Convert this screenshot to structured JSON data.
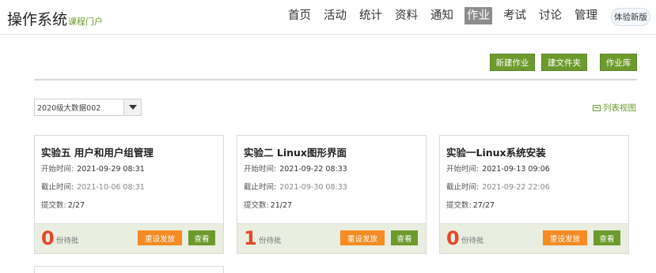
{
  "brand": {
    "title": "操作系统",
    "subtitle": "课程门户"
  },
  "nav": {
    "items": [
      {
        "label": "首页"
      },
      {
        "label": "活动"
      },
      {
        "label": "统计"
      },
      {
        "label": "资料"
      },
      {
        "label": "通知"
      },
      {
        "label": "作业",
        "active": true
      },
      {
        "label": "考试"
      },
      {
        "label": "讨论"
      },
      {
        "label": "管理"
      }
    ],
    "try_new": "体验新版"
  },
  "toolbar": {
    "new_assignment": "新建作业",
    "new_folder": "建文件夹",
    "library": "作业库"
  },
  "filter": {
    "class_selected": "2020级大数据002",
    "list_view_label": "列表视图",
    "list_view_icon": "list-icon"
  },
  "card_labels": {
    "start_prefix": "开始时间:",
    "end_prefix": "截止时间:",
    "submit_prefix": "提交数:",
    "pending_suffix": "份待批",
    "resend_button": "重设发放",
    "view_button": "查看"
  },
  "cards": [
    {
      "title": "实验五 用户和用户组管理",
      "start": "2021-09-29 08:31",
      "end": "2021-10-06 08:31",
      "submitted": "2/27",
      "pending": "0"
    },
    {
      "title": "实验二 Linux图形界面",
      "start": "2021-09-22 08:33",
      "end": "2021-09-30 08:33",
      "submitted": "21/27",
      "pending": "1"
    },
    {
      "title": "实验一Linux系统安装",
      "start": "2021-09-13 09:06",
      "end": "2021-09-22 22:06",
      "submitted": "27/27",
      "pending": "0"
    }
  ],
  "colors": {
    "accent_green": "#6d9a2c",
    "orange": "#f58b23",
    "pending_red": "#e4482a"
  }
}
